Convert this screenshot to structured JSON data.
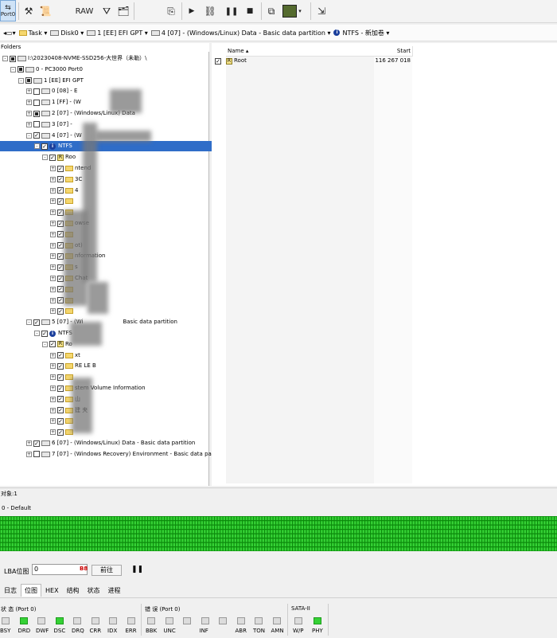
{
  "toolbar": {
    "port_label": "Port0",
    "raw_label": "RAW",
    "icons": [
      "tools-icon",
      "scroll-icon",
      "raw-icon",
      "filter-icon",
      "bag-icon",
      "export-icon",
      "play-icon",
      "network-icon",
      "pause-icon",
      "stop-icon",
      "copy-icon",
      "image-icon",
      "exit-icon"
    ]
  },
  "breadcrumb": {
    "items": [
      "Task ▾",
      "Disk0 ▾",
      "1 [EE] EFI GPT ▾",
      "4 [07] - (Windows/Linux) Data - Basic data partition ▾",
      "NTFS - 新加卷 ▾"
    ]
  },
  "folders": {
    "title": "Folders",
    "tree": [
      {
        "label": "I:\\20230408-NVME-SSD256-大世界（未勒）\\",
        "indent": 0,
        "exp": "-",
        "chk": "fill",
        "icon": "disk"
      },
      {
        "label": "0 - PC3000 Port0",
        "indent": 1,
        "exp": "-",
        "chk": "fill",
        "icon": "disk"
      },
      {
        "label": "1 [EE] EFI GPT",
        "indent": 2,
        "exp": "-",
        "chk": "fill",
        "icon": "disk"
      },
      {
        "label": "0 [08] - E",
        "indent": 3,
        "exp": "+",
        "chk": "",
        "icon": "disk"
      },
      {
        "label": "1 [FF] - (W",
        "indent": 3,
        "exp": "+",
        "chk": "",
        "icon": "disk"
      },
      {
        "label": "2 [07] - (Windows/Linux) Data",
        "indent": 3,
        "exp": "+",
        "chk": "fill",
        "icon": "disk"
      },
      {
        "label": "3 [07] -",
        "indent": 3,
        "exp": "+",
        "chk": "",
        "icon": "disk"
      },
      {
        "label": "4 [07] - (W",
        "indent": 3,
        "exp": "-",
        "chk": "check",
        "icon": "disk"
      },
      {
        "label": "NTFS",
        "indent": 4,
        "exp": "-",
        "chk": "check",
        "icon": "info",
        "selected": true
      },
      {
        "label": "Roo",
        "indent": 5,
        "exp": "-",
        "chk": "check",
        "icon": "r"
      },
      {
        "label": "ntend",
        "indent": 6,
        "exp": "+",
        "chk": "check",
        "icon": "folder"
      },
      {
        "label": "3C",
        "indent": 6,
        "exp": "+",
        "chk": "check",
        "icon": "folder"
      },
      {
        "label": "4",
        "indent": 6,
        "exp": "+",
        "chk": "check",
        "icon": "folder"
      },
      {
        "label": "",
        "indent": 6,
        "exp": "+",
        "chk": "check",
        "icon": "folder"
      },
      {
        "label": "",
        "indent": 6,
        "exp": "+",
        "chk": "check",
        "icon": "folder"
      },
      {
        "label": "owse",
        "indent": 6,
        "exp": "+",
        "chk": "check",
        "icon": "folder"
      },
      {
        "label": "",
        "indent": 6,
        "exp": "+",
        "chk": "check",
        "icon": "folder"
      },
      {
        "label": "ot)",
        "indent": 6,
        "exp": "+",
        "chk": "check",
        "icon": "folder"
      },
      {
        "label": "nformation",
        "indent": 6,
        "exp": "+",
        "chk": "check",
        "icon": "folder"
      },
      {
        "label": "s",
        "indent": 6,
        "exp": "+",
        "chk": "check",
        "icon": "folder"
      },
      {
        "label": "Chat",
        "indent": 6,
        "exp": "+",
        "chk": "check",
        "icon": "folder"
      },
      {
        "label": "",
        "indent": 6,
        "exp": "+",
        "chk": "check",
        "icon": "folder"
      },
      {
        "label": "",
        "indent": 6,
        "exp": "+",
        "chk": "check",
        "icon": "folder"
      },
      {
        "label": "",
        "indent": 6,
        "exp": "+",
        "chk": "check",
        "icon": "folder"
      },
      {
        "label": "5 [07] - (Wi",
        "indent": 3,
        "exp": "-",
        "chk": "check",
        "icon": "disk",
        "suffix": "Basic data partition"
      },
      {
        "label": "NTFS",
        "indent": 4,
        "exp": "-",
        "chk": "check",
        "icon": "info"
      },
      {
        "label": "Ro",
        "indent": 5,
        "exp": "-",
        "chk": "check",
        "icon": "r"
      },
      {
        "label": "xt",
        "indent": 6,
        "exp": "+",
        "chk": "check",
        "icon": "folder"
      },
      {
        "label": "RE LE B",
        "indent": 6,
        "exp": "+",
        "chk": "check",
        "icon": "folder"
      },
      {
        "label": "",
        "indent": 6,
        "exp": "+",
        "chk": "check",
        "icon": "folder"
      },
      {
        "label": "stem Volume Information",
        "indent": 6,
        "exp": "+",
        "chk": "check",
        "icon": "folder"
      },
      {
        "label": "山",
        "indent": 6,
        "exp": "+",
        "chk": "check",
        "icon": "folder"
      },
      {
        "label": "建  夹",
        "indent": 6,
        "exp": "+",
        "chk": "check",
        "icon": "folder"
      },
      {
        "label": "",
        "indent": 6,
        "exp": "+",
        "chk": "check",
        "icon": "folder"
      },
      {
        "label": "",
        "indent": 6,
        "exp": "+",
        "chk": "check",
        "icon": "folder"
      },
      {
        "label": "6 [07] - (Windows/Linux) Data - Basic data partition",
        "indent": 3,
        "exp": "+",
        "chk": "check",
        "icon": "disk"
      },
      {
        "label": "7 [07] - (Windows Recovery) Environment - Basic data partition",
        "indent": 3,
        "exp": "+",
        "chk": "",
        "icon": "disk"
      }
    ]
  },
  "files": {
    "headers": {
      "name": "Name",
      "start": "Start"
    },
    "rows": [
      {
        "name": "Root",
        "start": "116 267 018"
      }
    ]
  },
  "status": {
    "objects": "对象:1"
  },
  "sector_map": {
    "label": "0 - Default",
    "color": "#35d135",
    "grid_color": "#0c8a0c"
  },
  "lba": {
    "label": "LBA位图",
    "value": "0",
    "go_label": "前往"
  },
  "tabs": [
    "日志",
    "位图",
    "HEX",
    "结构",
    "状态",
    "进程"
  ],
  "status_group": {
    "title": "状 态 (Port 0)",
    "leds": [
      {
        "name": "BSY",
        "on": false
      },
      {
        "name": "DRD",
        "on": true
      },
      {
        "name": "DWF",
        "on": false
      },
      {
        "name": "DSC",
        "on": true
      },
      {
        "name": "DRQ",
        "on": false
      },
      {
        "name": "CRR",
        "on": false
      },
      {
        "name": "IDX",
        "on": false
      },
      {
        "name": "ERR",
        "on": false
      }
    ]
  },
  "error_group": {
    "title": "错 误 (Port 0)",
    "leds": [
      {
        "name": "BBK",
        "on": false
      },
      {
        "name": "UNC",
        "on": false
      },
      {
        "name": "",
        "on": false
      },
      {
        "name": "INF",
        "on": false
      },
      {
        "name": "",
        "on": false
      },
      {
        "name": "ABR",
        "on": false
      },
      {
        "name": "TON",
        "on": false
      },
      {
        "name": "AMN",
        "on": false
      }
    ]
  },
  "sata_group": {
    "title": "SATA-II",
    "leds": [
      {
        "name": "W/P",
        "on": false
      },
      {
        "name": "PHY",
        "on": true
      }
    ]
  }
}
